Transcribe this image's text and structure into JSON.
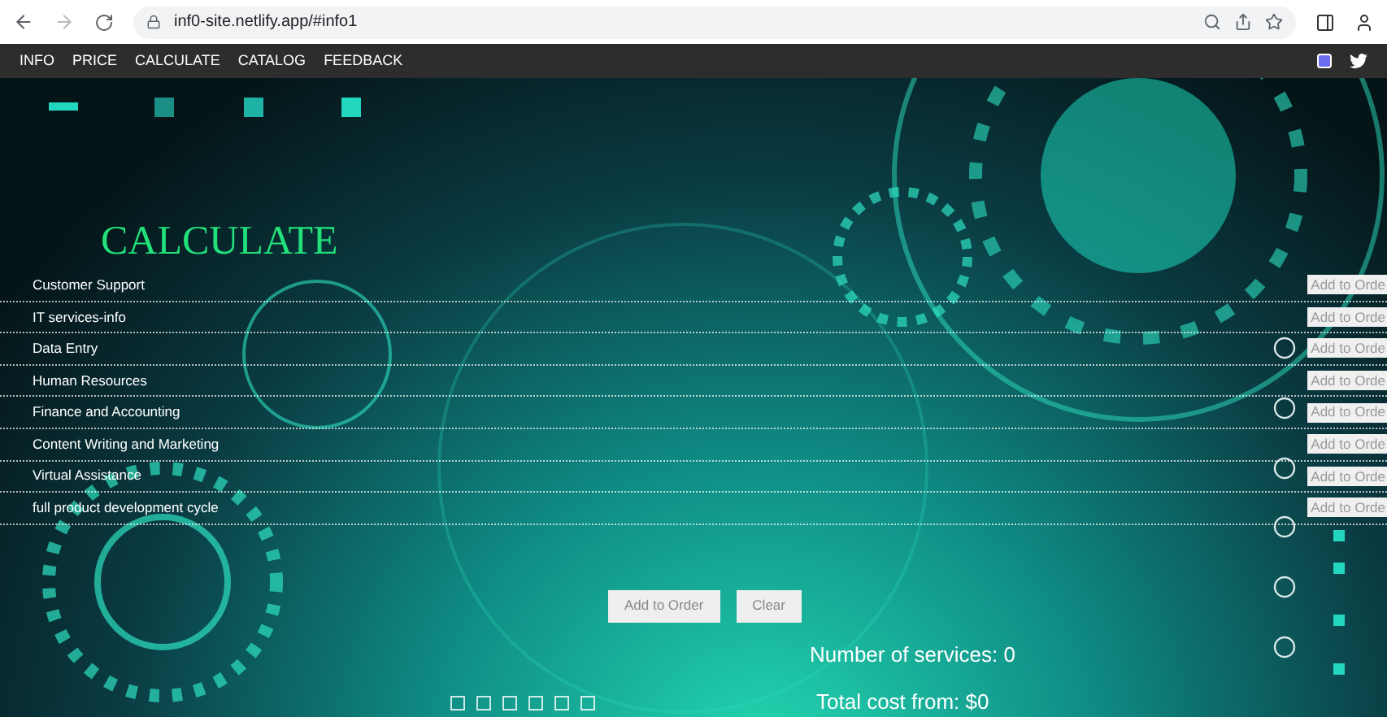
{
  "browser": {
    "url": "inf0-site.netlify.app/#info1"
  },
  "nav": {
    "items": [
      {
        "label": "INFO"
      },
      {
        "label": "PRICE"
      },
      {
        "label": "CALCULATE"
      },
      {
        "label": "CATALOG"
      },
      {
        "label": "FEEDBACK"
      }
    ]
  },
  "calculator": {
    "title": "CALCULATE",
    "services": [
      {
        "name": "Customer Support",
        "button": "Add to Orde"
      },
      {
        "name": "IT services-info",
        "button": "Add to Orde"
      },
      {
        "name": "Data Entry",
        "button": "Add to Orde"
      },
      {
        "name": "Human Resources",
        "button": "Add to Orde"
      },
      {
        "name": "Finance and Accounting",
        "button": "Add to Orde"
      },
      {
        "name": "Content Writing and Marketing",
        "button": "Add to Orde"
      },
      {
        "name": "Virtual Assistance",
        "button": "Add to Orde"
      },
      {
        "name": "full product development cycle",
        "button": "Add to Orde"
      }
    ],
    "actions": [
      "Add to Order",
      "Clear"
    ],
    "services_count": "Number of services: 0",
    "total_cost": "Total cost from: $0"
  },
  "slider_dots": [
    {
      "selected": false
    },
    {
      "selected": false
    },
    {
      "selected": false
    },
    {
      "selected": false
    },
    {
      "selected": false
    },
    {
      "selected": false
    }
  ]
}
